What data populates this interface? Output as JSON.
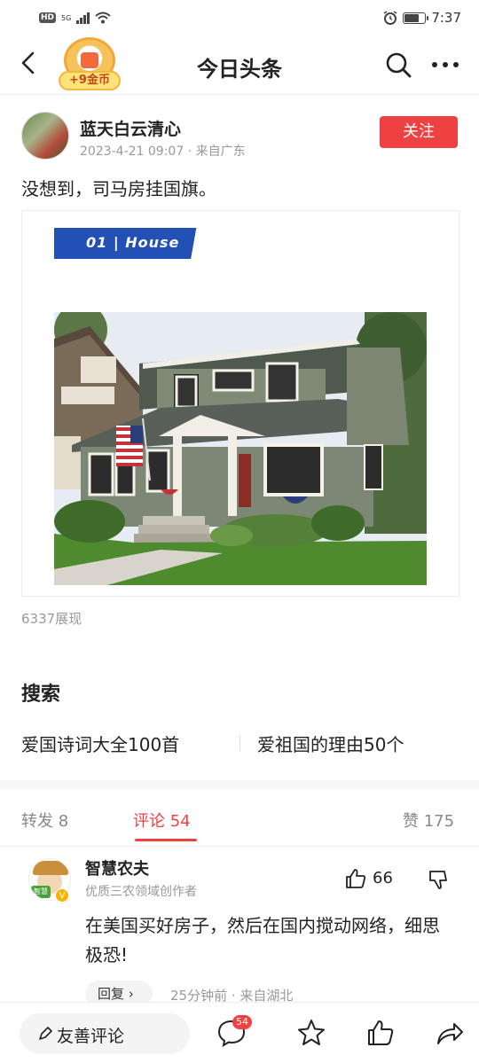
{
  "status_bar": {
    "network_badge": "HD",
    "network_type": "5G",
    "time": "7:37",
    "battery_level": 0.7
  },
  "nav": {
    "title": "今日头条",
    "coin_reward": "+9金币"
  },
  "author": {
    "name": "蓝天白云清心",
    "meta": "2023-4-21 09:07 · 来自广东",
    "follow_label": "关注"
  },
  "post": {
    "text": "没想到，司马房挂国旗。",
    "image_label": "01 | House",
    "views": "6337展现"
  },
  "search": {
    "title": "搜索",
    "items": [
      "爱国诗词大全100首",
      "爱祖国的理由50个"
    ]
  },
  "tabs": [
    {
      "label": "转发 8"
    },
    {
      "label": "评论 54"
    },
    {
      "label": "赞 175"
    }
  ],
  "comment": {
    "name": "智慧农夫",
    "avatar_tag": "智慧",
    "verified_mark": "V",
    "title": "优质三农领域创作者",
    "likes": "66",
    "text": "在美国买好房子，然后在国内搅动网络，细思极恐!",
    "reply_label": "回复 ›",
    "meta": "25分钟前 · 来自湖北"
  },
  "bottom_bar": {
    "input_label": "友善评论",
    "comment_badge": "54"
  },
  "colors": {
    "accent": "#f04142",
    "label_blue": "#2350b4"
  }
}
